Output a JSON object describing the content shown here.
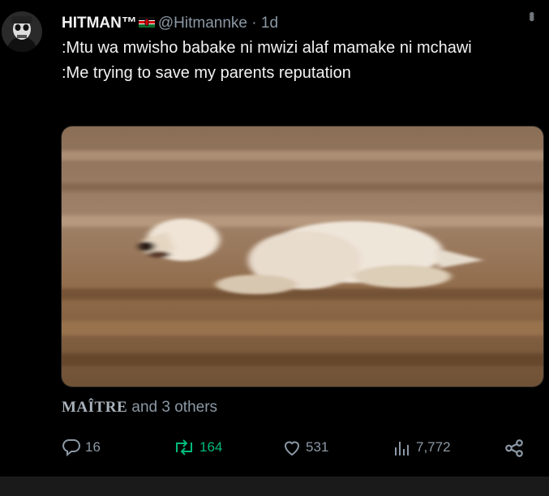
{
  "tweet": {
    "author_name": "HITMAN™",
    "handle": "@Hitmannke",
    "separator": " · ",
    "time": "1d",
    "lines": [
      ":Mtu wa mwisho babake ni mwizi alaf mamake ni mchawi",
      ":Me trying to save my parents reputation"
    ]
  },
  "media": {
    "description_icon": "running-dog-photo"
  },
  "likers": {
    "first": "MAÎTRE",
    "rest": " and 3 others"
  },
  "actions": {
    "replies": "16",
    "retweets": "164",
    "likes": "531",
    "views": "7,772"
  },
  "colors": {
    "background": "#000000",
    "text": "#e7e9ea",
    "muted": "#8b98a5",
    "retweet": "#00ba7c"
  }
}
